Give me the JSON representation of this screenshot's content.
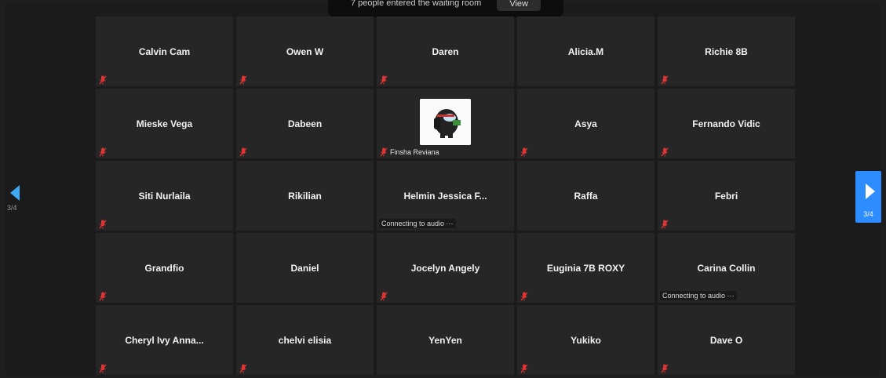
{
  "banner": {
    "message": "7 people entered the waiting room",
    "view_label": "View"
  },
  "pagination": {
    "left_label": "3/4",
    "right_label": "3/4",
    "accent_color": "#2d8cff"
  },
  "icons": {
    "muted": "mic-muted-icon"
  },
  "tiles": [
    {
      "name": "Calvin Cam",
      "muted": true
    },
    {
      "name": "Owen W",
      "muted": true
    },
    {
      "name": "Daren",
      "muted": true
    },
    {
      "name": "Alicia.M",
      "muted": false
    },
    {
      "name": "Richie 8B",
      "muted": true
    },
    {
      "name": "Mieske Vega",
      "muted": true
    },
    {
      "name": "Dabeen",
      "muted": true
    },
    {
      "name": "Finsha Reviana",
      "muted": true,
      "has_video": true
    },
    {
      "name": "Asya",
      "muted": true
    },
    {
      "name": "Fernando Vidic",
      "muted": true
    },
    {
      "name": "Siti Nurlaila",
      "muted": true
    },
    {
      "name": "Rikilian",
      "muted": false
    },
    {
      "name": "Helmin Jessica F...",
      "muted": false,
      "status": "Connecting to audio ···"
    },
    {
      "name": "Raffa",
      "muted": false
    },
    {
      "name": "Febri",
      "muted": true
    },
    {
      "name": "Grandfio",
      "muted": true
    },
    {
      "name": "Daniel",
      "muted": false
    },
    {
      "name": "Jocelyn Angely",
      "muted": true
    },
    {
      "name": "Euginia 7B ROXY",
      "muted": true
    },
    {
      "name": "Carina Collin",
      "muted": false,
      "status": "Connecting to audio ···"
    },
    {
      "name": "Cheryl Ivy Anna...",
      "muted": true
    },
    {
      "name": "chelvi elisia",
      "muted": true
    },
    {
      "name": "YenYen",
      "muted": false
    },
    {
      "name": "Yukiko",
      "muted": true
    },
    {
      "name": "Dave O",
      "muted": true
    }
  ]
}
